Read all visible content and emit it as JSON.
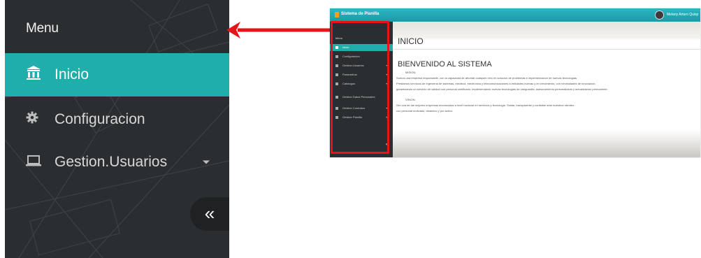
{
  "zoom": {
    "menu_title": "Menu",
    "items": [
      {
        "label": "Inicio",
        "icon": "bank-icon",
        "active": true
      },
      {
        "label": "Configuracion",
        "icon": "gear-icon",
        "active": false
      },
      {
        "label": "Gestion.Usuarios",
        "icon": "laptop-icon",
        "active": false
      }
    ],
    "collapse_label": "«"
  },
  "thumbnail": {
    "app_title": "Sistema de Planilla",
    "user_name": "Melany Arturo Quisp",
    "menu_title": "Menu",
    "sidebar_items": [
      "Inicio",
      "Configuracion",
      "Gestion.Usuarios",
      "Parametros",
      "Catalogos",
      "Gestion Datos Personales",
      "Gestion Contratos",
      "Gestion Planilla"
    ],
    "collapse_label": "«",
    "page_title": "INICIO",
    "welcome": "BIENVENIDO AL SISTEMA",
    "mision_label": "MISION:",
    "mision_lines": [
      "Somos una empresa responsable, con la capacidad de afrontar cualquier reto en solucion de problemas e implementacion de nuevas tecnologias.",
      "Prestamos servicios de ingenieria de sistemas, electrica, electronica y telecomunicaciones a entidades nuevas y en crecimiento, con necesidades de innovacion,",
      "garantizando un servicio de calidad con personal certificado, implementando nuevas tecnologias de vanguardia, asesoramiento personalizado y actualizacion permanente."
    ],
    "vision_label": "VISION:",
    "vision_lines": [
      "Ser una de las mejores empresas reconocidas a nivel nacional en servicios y tecnologia. Solida, transparente y confiable ante nuestros clientes,",
      "con personal motivado, dinamico y pro activo."
    ]
  },
  "colors": {
    "accent_teal": "#20aeab",
    "sidebar_dark": "#2b2e31",
    "highlight_red": "#e4141b"
  }
}
